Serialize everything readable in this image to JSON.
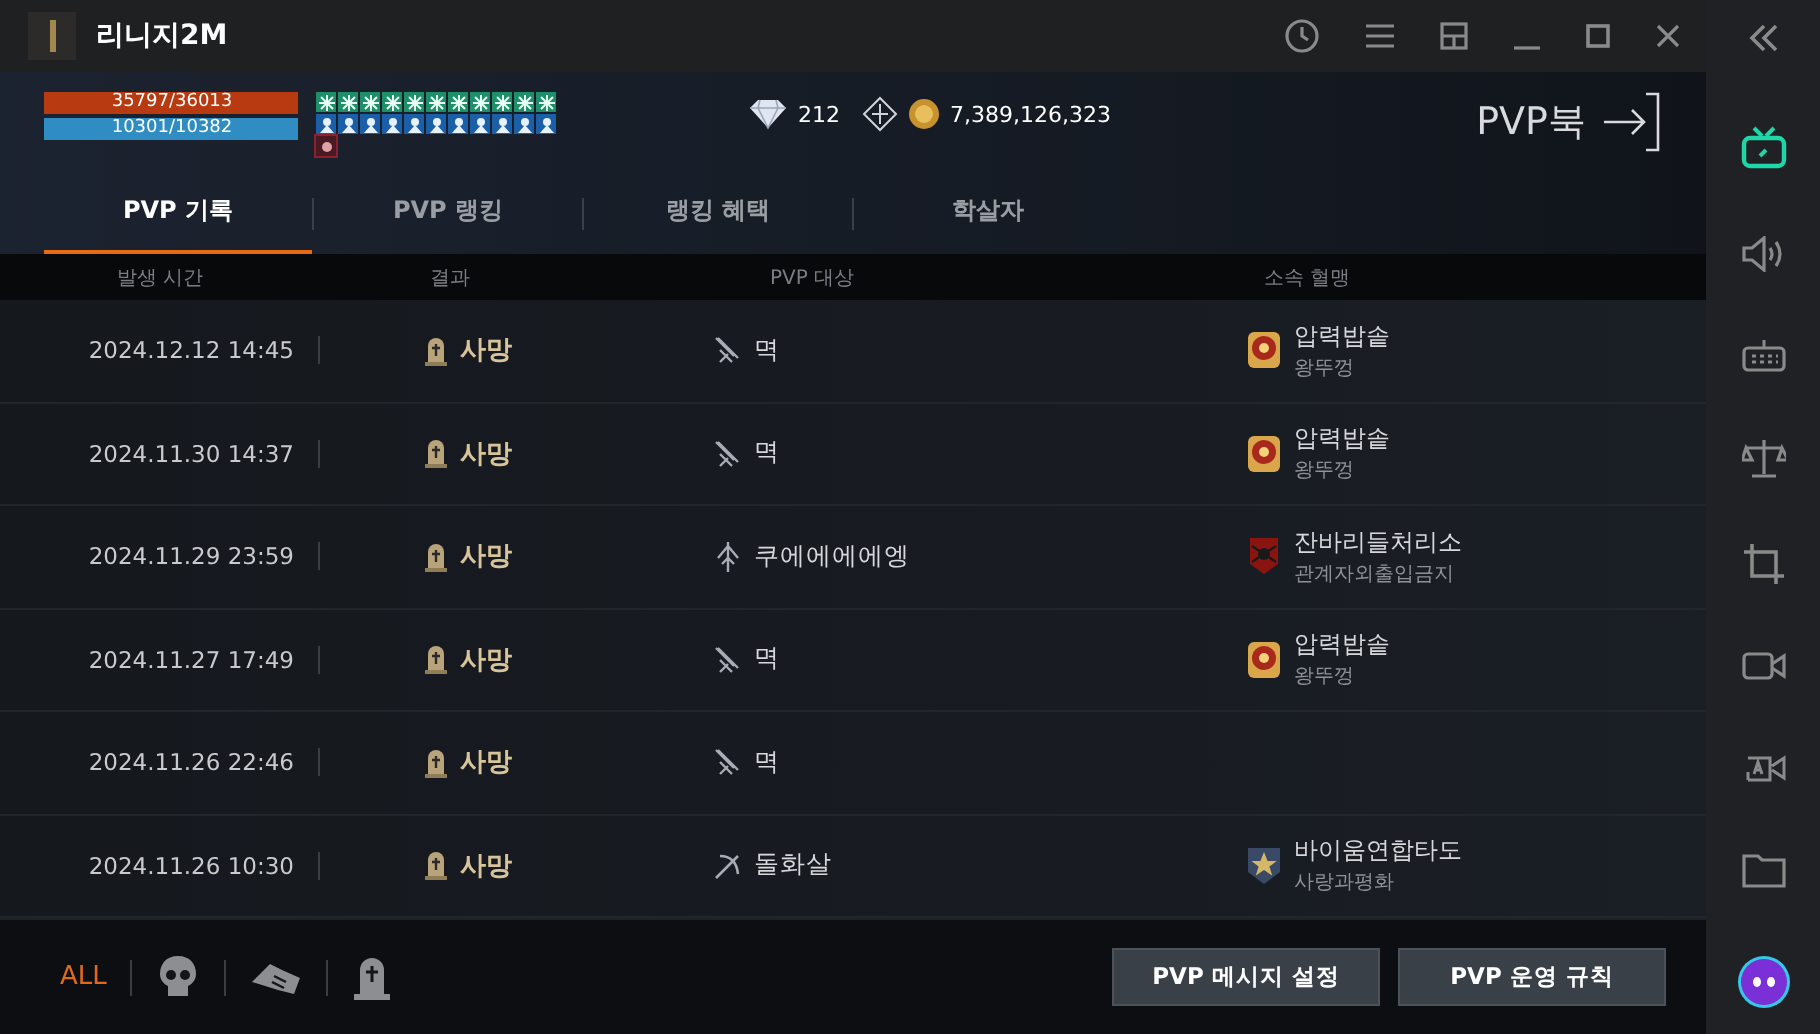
{
  "window": {
    "title": "리니지2M"
  },
  "status": {
    "hp": {
      "reading": "35797/36013",
      "level": 0.994
    },
    "mp": {
      "reading": "10301/10382",
      "level": 0.992
    }
  },
  "currency": {
    "diamonds": "212",
    "adena": "7,389,126,323"
  },
  "book": {
    "label": "PVP북"
  },
  "tabs": [
    {
      "label": "PVP 기록",
      "selected": true
    },
    {
      "label": "PVP 랭킹",
      "selected": false
    },
    {
      "label": "랭킹 혜택",
      "selected": false
    },
    {
      "label": "학살자",
      "selected": false
    }
  ],
  "table": {
    "columns": [
      "발생 시간",
      "결과",
      "PVP 대상",
      "소속 혈맹"
    ],
    "rows": [
      {
        "time": "2024.12.12 14:45",
        "result": "사망",
        "target": {
          "kind": "dagger",
          "name": "멱"
        },
        "guild": {
          "kind": "sun",
          "name": "압력밥솥",
          "sub": "왕뚜껑"
        }
      },
      {
        "time": "2024.11.30 14:37",
        "result": "사망",
        "target": {
          "kind": "dagger",
          "name": "멱"
        },
        "guild": {
          "kind": "sun",
          "name": "압력밥솥",
          "sub": "왕뚜껑"
        }
      },
      {
        "time": "2024.11.29 23:59",
        "result": "사망",
        "target": {
          "kind": "staff",
          "name": "쿠에에에에엥"
        },
        "guild": {
          "kind": "spider",
          "name": "잔바리들처리소",
          "sub": "관계자외출입금지"
        }
      },
      {
        "time": "2024.11.27 17:49",
        "result": "사망",
        "target": {
          "kind": "dagger",
          "name": "멱"
        },
        "guild": {
          "kind": "sun",
          "name": "압력밥솥",
          "sub": "왕뚜껑"
        }
      },
      {
        "time": "2024.11.26 22:46",
        "result": "사망",
        "target": {
          "kind": "dagger",
          "name": "멱"
        }
      },
      {
        "time": "2024.11.26 10:30",
        "result": "사망",
        "target": {
          "kind": "crossbow",
          "name": "돌화살"
        },
        "guild": {
          "kind": "star",
          "name": "바이움연합타도",
          "sub": "사랑과평화"
        }
      }
    ]
  },
  "filters": [
    {
      "kind": "text",
      "label": "ALL",
      "selected": true
    },
    {
      "kind": "skull",
      "selected": false
    },
    {
      "kind": "hand",
      "selected": false
    },
    {
      "kind": "grave",
      "selected": false
    }
  ],
  "buttons": [
    "PVP 메시지 설정",
    "PVP 운영 규칙"
  ]
}
